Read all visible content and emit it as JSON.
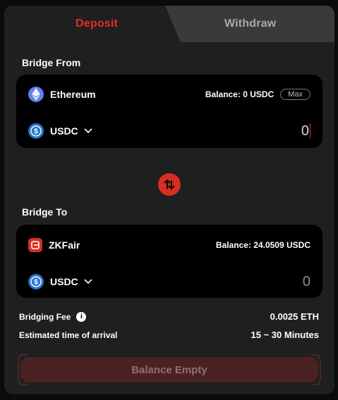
{
  "tabs": {
    "deposit": "Deposit",
    "withdraw": "Withdraw",
    "active": "deposit"
  },
  "bridge_from": {
    "label": "Bridge From",
    "network": "Ethereum",
    "network_icon": "ethereum-icon",
    "balance": "Balance: 0 USDC",
    "max_label": "Max",
    "token": "USDC",
    "token_icon": "usdc-icon",
    "amount": "0"
  },
  "bridge_to": {
    "label": "Bridge To",
    "network": "ZKFair",
    "network_icon": "zkfair-icon",
    "balance": "Balance: 24.0509 USDC",
    "token": "USDC",
    "token_icon": "usdc-icon",
    "amount": "0"
  },
  "info": {
    "fee_label": "Bridging Fee",
    "fee_value": "0.0025 ETH",
    "eta_label": "Estimated time of arrival",
    "eta_value": "15 ~ 30 Minutes"
  },
  "submit": {
    "label": "Balance Empty"
  },
  "colors": {
    "accent": "#e52d27",
    "panel": "#1f1f1f",
    "card": "#000000",
    "button_disabled": "#4b2222",
    "usdc": "#2775ca",
    "ethereum": "#627eea"
  }
}
